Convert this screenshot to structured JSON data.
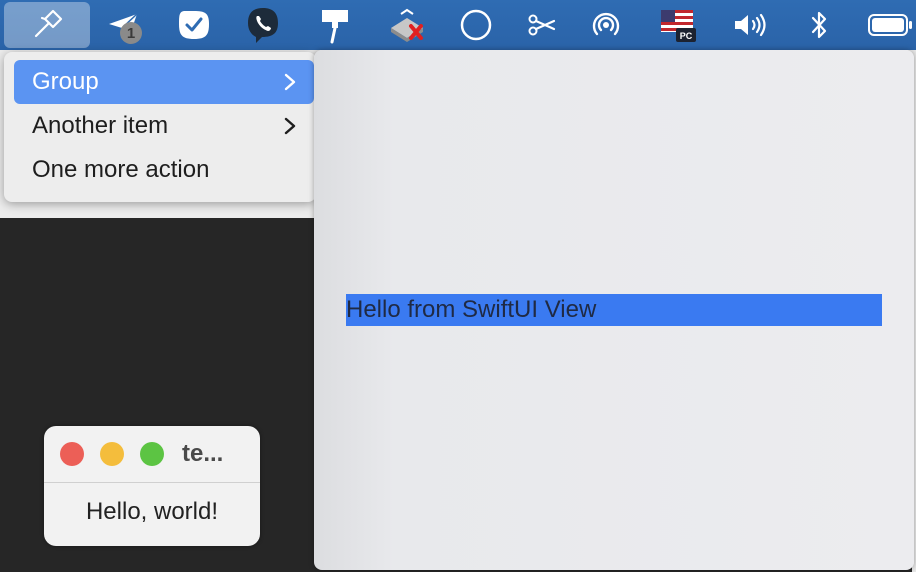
{
  "menubar": {
    "badge_count": "1",
    "flag_label": "PC"
  },
  "menu": {
    "items": [
      {
        "label": "Group",
        "has_submenu": true,
        "selected": true
      },
      {
        "label": "Another item",
        "has_submenu": true,
        "selected": false
      },
      {
        "label": "One more action",
        "has_submenu": false,
        "selected": false
      }
    ]
  },
  "submenu": {
    "content_text": "Hello from SwiftUI View"
  },
  "window": {
    "title": "te...",
    "body_text": "Hello, world!"
  },
  "colors": {
    "menubar": "#2f6cb3",
    "selection": "#5b94f2",
    "swiftui_view": "#3a7af1"
  }
}
